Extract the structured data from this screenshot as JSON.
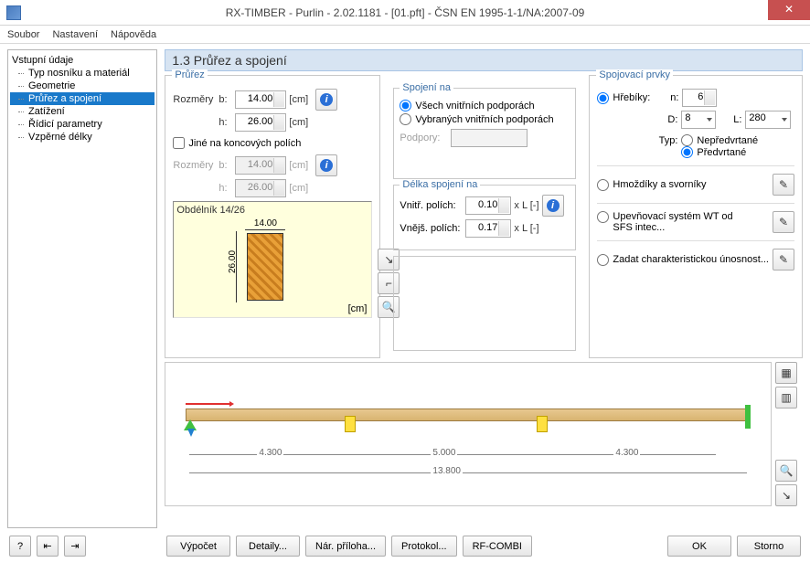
{
  "window": {
    "title": "RX-TIMBER - Purlin - 2.02.1181 - [01.pft] - ČSN EN 1995-1-1/NA:2007-09"
  },
  "menu": {
    "file": "Soubor",
    "settings": "Nastavení",
    "help": "Nápověda"
  },
  "nav": {
    "root": "Vstupní údaje",
    "items": [
      "Typ nosníku a materiál",
      "Geometrie",
      "Průřez a spojení",
      "Zatížení",
      "Řídicí parametry",
      "Vzpěrné délky"
    ],
    "selected": 2
  },
  "page_title": "1.3 Průřez a spojení",
  "section": {
    "title": "Průřez",
    "rozmery": "Rozměry",
    "b": "b:",
    "b_val": "14.00",
    "h": "h:",
    "h_val": "26.00",
    "unit": "[cm]",
    "check_label": "Jiné na koncových polích",
    "b2": "14.00",
    "h2": "26.00",
    "preview_title": "Obdélník 14/26",
    "dim_b": "14.00",
    "dim_h": "26.00"
  },
  "join": {
    "group_title": "Spojení na",
    "r1": "Všech vnitřních podporách",
    "r2": "Vybraných vnitřních podporách",
    "podpory": "Podpory:",
    "len_title": "Délka spojení na",
    "inner": "Vnitř. polích:",
    "inner_val": "0.10",
    "outer": "Vnějš. polích:",
    "outer_val": "0.17",
    "xl": "x L [-]"
  },
  "fasteners": {
    "title": "Spojovací prvky",
    "nails": "Hřebíky:",
    "n": "n:",
    "n_val": "6",
    "D": "D:",
    "D_val": "8",
    "L": "L:",
    "L_val": "280",
    "typ": "Typ:",
    "r_nepred": "Nepředvrtané",
    "r_pred": "Předvrtané",
    "dowels": "Hmoždíky a svorníky",
    "wt": "Upevňovací systém WT od SFS intec...",
    "char": "Zadat charakteristickou únosnost..."
  },
  "beam": {
    "span1": "4.300",
    "span2": "5.000",
    "span3": "4.300",
    "total": "13.800"
  },
  "footer": {
    "calc": "Výpočet",
    "details": "Detaily...",
    "nar": "Nár. příloha...",
    "protokol": "Protokol...",
    "rfcombi": "RF-COMBI",
    "ok": "OK",
    "storno": "Storno"
  }
}
